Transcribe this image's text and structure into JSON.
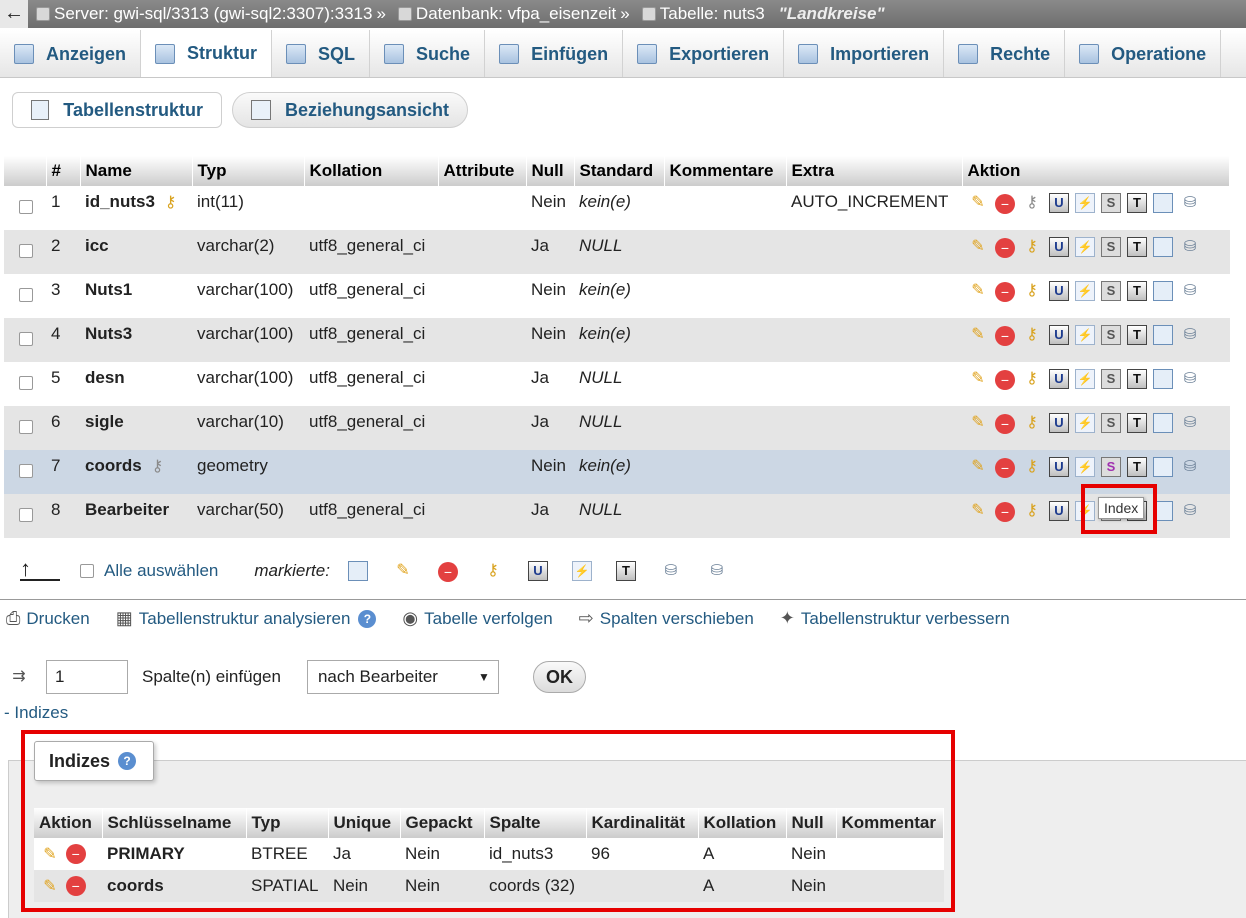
{
  "breadcrumb": {
    "back": "←",
    "server": "Server: gwi-sql/3313 (gwi-sql2:3307):3313",
    "sep": "»",
    "database": "Datenbank: vfpa_eisenzeit",
    "table": "Tabelle: nuts3",
    "table_comment": "\"Landkreise\""
  },
  "tabs": [
    {
      "label": "Anzeigen",
      "icon": "browse-icon"
    },
    {
      "label": "Struktur",
      "icon": "structure-icon"
    },
    {
      "label": "SQL",
      "icon": "sql-icon"
    },
    {
      "label": "Suche",
      "icon": "search-icon"
    },
    {
      "label": "Einfügen",
      "icon": "insert-icon"
    },
    {
      "label": "Exportieren",
      "icon": "export-icon"
    },
    {
      "label": "Importieren",
      "icon": "import-icon"
    },
    {
      "label": "Rechte",
      "icon": "privileges-icon"
    },
    {
      "label": "Operatione",
      "icon": "wrench-icon"
    }
  ],
  "subtabs": {
    "structure": "Tabellenstruktur",
    "relations": "Beziehungsansicht"
  },
  "columns_header": [
    "#",
    "Name",
    "Typ",
    "Kollation",
    "Attribute",
    "Null",
    "Standard",
    "Kommentare",
    "Extra",
    "Aktion"
  ],
  "rows": [
    {
      "num": "1",
      "name": "id_nuts3",
      "type": "int(11)",
      "collation": "",
      "attributes": "",
      "null": "Nein",
      "default": "kein(e)",
      "comments": "",
      "extra": "AUTO_INCREMENT",
      "key": "primary"
    },
    {
      "num": "2",
      "name": "icc",
      "type": "varchar(2)",
      "collation": "utf8_general_ci",
      "attributes": "",
      "null": "Ja",
      "default": "NULL",
      "comments": "",
      "extra": ""
    },
    {
      "num": "3",
      "name": "Nuts1",
      "type": "varchar(100)",
      "collation": "utf8_general_ci",
      "attributes": "",
      "null": "Nein",
      "default": "kein(e)",
      "comments": "",
      "extra": ""
    },
    {
      "num": "4",
      "name": "Nuts3",
      "type": "varchar(100)",
      "collation": "utf8_general_ci",
      "attributes": "",
      "null": "Nein",
      "default": "kein(e)",
      "comments": "",
      "extra": ""
    },
    {
      "num": "5",
      "name": "desn",
      "type": "varchar(100)",
      "collation": "utf8_general_ci",
      "attributes": "",
      "null": "Ja",
      "default": "NULL",
      "comments": "",
      "extra": ""
    },
    {
      "num": "6",
      "name": "sigle",
      "type": "varchar(10)",
      "collation": "utf8_general_ci",
      "attributes": "",
      "null": "Ja",
      "default": "NULL",
      "comments": "",
      "extra": ""
    },
    {
      "num": "7",
      "name": "coords",
      "type": "geometry",
      "collation": "",
      "attributes": "",
      "null": "Nein",
      "default": "kein(e)",
      "comments": "",
      "extra": "",
      "key": "spatial"
    },
    {
      "num": "8",
      "name": "Bearbeiter",
      "type": "varchar(50)",
      "collation": "utf8_general_ci",
      "attributes": "",
      "null": "Ja",
      "default": "NULL",
      "comments": "",
      "extra": ""
    }
  ],
  "tooltip": "Index",
  "bulk": {
    "select_all": "Alle auswählen",
    "with_selected": "markierte:"
  },
  "links": {
    "print": "Drucken",
    "analyze": "Tabellenstruktur analysieren",
    "track": "Tabelle verfolgen",
    "move": "Spalten verschieben",
    "improve": "Tabellenstruktur verbessern"
  },
  "add_columns": {
    "count": "1",
    "label": "Spalte(n) einfügen",
    "position": "nach Bearbeiter",
    "ok": "OK"
  },
  "indexes_toggle": "- Indizes",
  "indexes": {
    "legend": "Indizes",
    "header": [
      "Aktion",
      "Schlüsselname",
      "Typ",
      "Unique",
      "Gepackt",
      "Spalte",
      "Kardinalität",
      "Kollation",
      "Null",
      "Kommentar"
    ],
    "rows": [
      {
        "key_name": "PRIMARY",
        "type": "BTREE",
        "unique": "Ja",
        "packed": "Nein",
        "column": "id_nuts3",
        "cardinality": "96",
        "collation": "A",
        "null": "Nein",
        "comment": ""
      },
      {
        "key_name": "coords",
        "type": "SPATIAL",
        "unique": "Nein",
        "packed": "Nein",
        "column": "coords (32)",
        "cardinality": "",
        "collation": "A",
        "null": "Nein",
        "comment": ""
      }
    ]
  },
  "colors": {
    "link": "#235a81",
    "highlight": "#e60000",
    "row_alt": "#e5e5e5",
    "row_hover": "#ccd7e4"
  }
}
